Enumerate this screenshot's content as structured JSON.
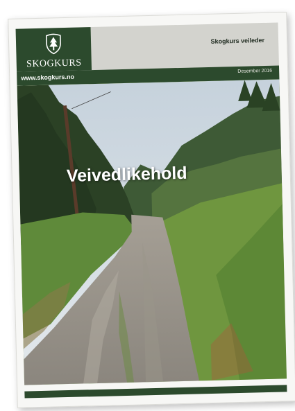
{
  "brand": {
    "logo_text": "SKOGKURS",
    "url": "www.skogkurs.no"
  },
  "header": {
    "series_title": "Skogkurs veileder",
    "date": "Desember 2016"
  },
  "cover": {
    "title": "Veivedlikehold"
  },
  "colors": {
    "brand_green": "#2c4a2d",
    "header_grey": "#d3d3ce"
  },
  "icons": {
    "logo": "tree-shield-icon"
  }
}
